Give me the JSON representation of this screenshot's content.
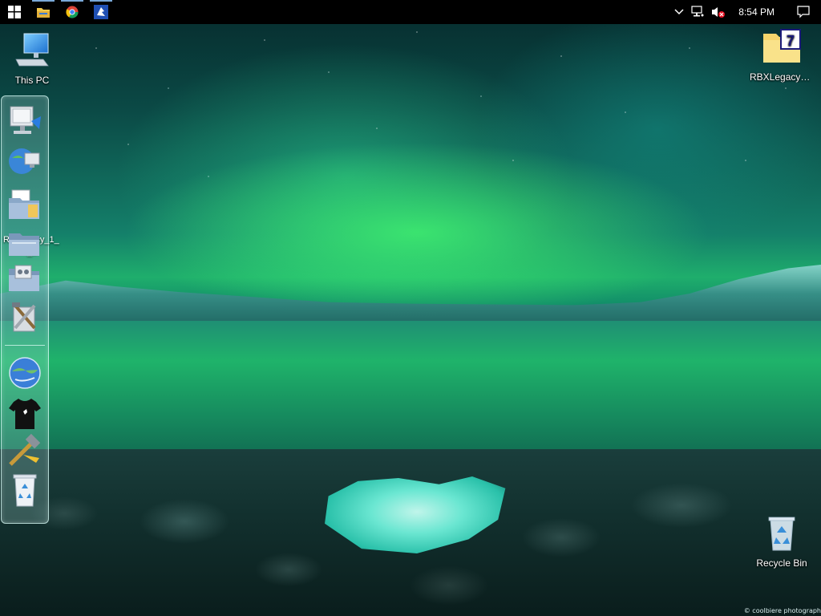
{
  "taskbar": {
    "start_icon": "windows-logo-icon",
    "pinned": [
      {
        "name": "file-explorer",
        "icon": "folder-icon"
      },
      {
        "name": "chrome",
        "icon": "chrome-icon"
      },
      {
        "name": "roblox-legacy",
        "icon": "roblox-legacy-icon"
      }
    ],
    "tray": {
      "chevron": "show-hidden-icons-icon",
      "network": "network-icon",
      "volume": "volume-muted-icon",
      "time": "8:54 PM",
      "notifications": "action-center-icon"
    }
  },
  "desktop": {
    "icons": [
      {
        "name": "this-pc",
        "label": "This PC",
        "icon": "computer-icon"
      },
      {
        "name": "rbxlegacy",
        "label": "RBXLegacy_...",
        "icon": "archive-folder-icon"
      },
      {
        "name": "recycle-bin",
        "label": "Recycle Bin",
        "icon": "recycle-bin-icon"
      }
    ]
  },
  "dock": {
    "ghost_labels": [
      "e",
      "Rbxlegacy_1_",
      "_1"
    ],
    "items": [
      {
        "name": "computer",
        "icon": "computer-monitor-icon"
      },
      {
        "name": "network",
        "icon": "network-globe-icon"
      },
      {
        "name": "documents",
        "icon": "documents-folder-icon"
      },
      {
        "name": "folder",
        "icon": "folder-icon"
      },
      {
        "name": "control-panel",
        "icon": "control-panel-folder-icon"
      },
      {
        "name": "tools",
        "icon": "tools-icon"
      },
      {
        "name": "browser",
        "icon": "globe-icon"
      },
      {
        "name": "shirt",
        "icon": "tshirt-icon"
      },
      {
        "name": "utilities",
        "icon": "hammer-icon"
      },
      {
        "name": "trash",
        "icon": "trash-icon"
      }
    ]
  },
  "wallpaper": {
    "credit": "© coolbiere photograph"
  },
  "colors": {
    "taskbar": "#000000",
    "aurora": "#2fd86f",
    "pinned_indicator": "#7aa8d8"
  }
}
